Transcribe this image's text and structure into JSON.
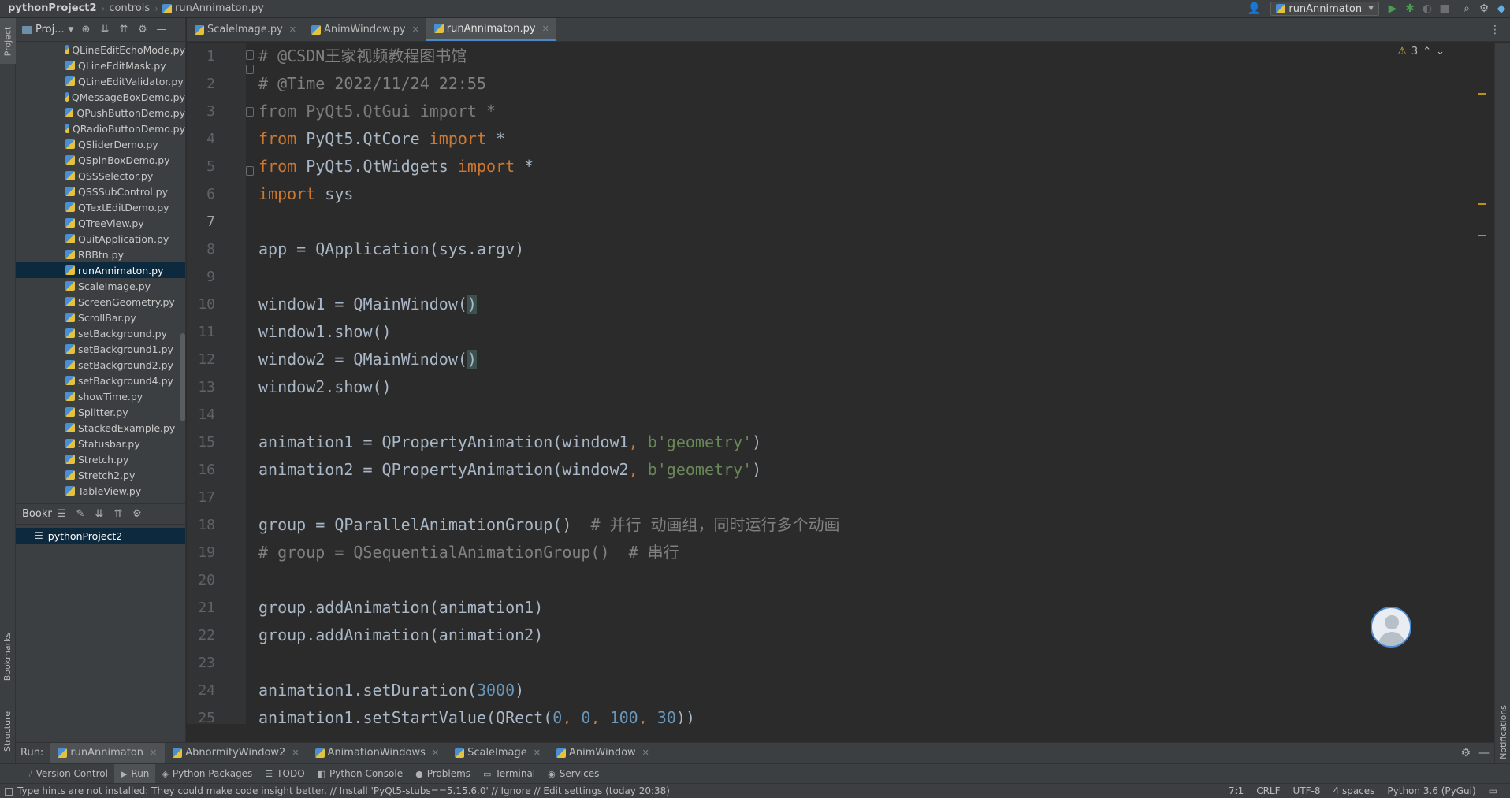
{
  "navbar": {
    "project": "pythonProject2",
    "folder": "controls",
    "file": "runAnnimaton.py",
    "run_config": "runAnnimaton"
  },
  "stripe": {
    "project_label": "Project",
    "bookmarks_label": "Bookmarks",
    "structure_label": "Structure",
    "notifications_label": "Notifications"
  },
  "project_panel": {
    "title": "Proj...",
    "files": [
      "QLineEditEchoMode.py",
      "QLineEditMask.py",
      "QLineEditValidator.py",
      "QMessageBoxDemo.py",
      "QPushButtonDemo.py",
      "QRadioButtonDemo.py",
      "QSliderDemo.py",
      "QSpinBoxDemo.py",
      "QSSSelector.py",
      "QSSSubControl.py",
      "QTextEditDemo.py",
      "QTreeView.py",
      "QuitApplication.py",
      "RBBtn.py",
      "runAnnimaton.py",
      "ScaleImage.py",
      "ScreenGeometry.py",
      "ScrollBar.py",
      "setBackground.py",
      "setBackground1.py",
      "setBackground2.py",
      "setBackground4.py",
      "showTime.py",
      "Splitter.py",
      "StackedExample.py",
      "Statusbar.py",
      "Stretch.py",
      "Stretch2.py",
      "TableView.py"
    ],
    "selected_index": 14
  },
  "bookmarks_panel": {
    "title": "Bookm",
    "item": "pythonProject2"
  },
  "editor_tabs": [
    {
      "label": "ScaleImage.py",
      "active": false
    },
    {
      "label": "AnimWindow.py",
      "active": false
    },
    {
      "label": "runAnnimaton.py",
      "active": true
    }
  ],
  "editor": {
    "warnings": "3",
    "line_numbers": [
      "1",
      "2",
      "3",
      "4",
      "5",
      "6",
      "7",
      "8",
      "9",
      "10",
      "11",
      "12",
      "13",
      "14",
      "15",
      "16",
      "17",
      "18",
      "19",
      "20",
      "21",
      "22",
      "23",
      "24",
      "25"
    ],
    "current_line": "7",
    "code": {
      "l1": "# @CSDN王家视频教程图书馆",
      "l2": "# @Time 2022/11/24 22:55",
      "l3a": "from ",
      "l3b": "PyQt5.QtGui ",
      "l3c": "import ",
      "l3d": "*",
      "l4a": "from ",
      "l4b": "PyQt5.QtCore ",
      "l4c": "import ",
      "l4d": "*",
      "l5a": "from ",
      "l5b": "PyQt5.QtWidgets ",
      "l5c": "import ",
      "l5d": "*",
      "l6a": "import ",
      "l6b": "sys",
      "l8": "app = QApplication(sys.argv)",
      "l10a": "window1 = QMainWindow(",
      "l10b": ")",
      "l11": "window1.show()",
      "l12a": "window2 = QMainWindow(",
      "l12b": ")",
      "l13": "window2.show()",
      "l15a": "animation1 = QPropertyAnimation(window1",
      "l15b": ", ",
      "l15c": "b'geometry'",
      "l15d": ")",
      "l16a": "animation2 = QPropertyAnimation(window2",
      "l16b": ", ",
      "l16c": "b'geometry'",
      "l16d": ")",
      "l18a": "group = QParallelAnimationGroup()  ",
      "l18b": "# 并行 动画组，同时运行多个动画",
      "l19": "# group = QSequentialAnimationGroup()  # 串行",
      "l21": "group.addAnimation(animation1)",
      "l22": "group.addAnimation(animation2)",
      "l24a": "animation1.setDuration(",
      "l24b": "3000",
      "l24c": ")",
      "l25a": "animation1.setStartValue(QRect(",
      "l25b": "0",
      "l25c": ", ",
      "l25d": "0",
      "l25e": ", ",
      "l25f": "100",
      "l25g": ", ",
      "l25h": "30",
      "l25i": "))"
    }
  },
  "run_bar": {
    "label": "Run:",
    "tabs": [
      "runAnnimaton",
      "AbnormityWindow2",
      "AnimationWindows",
      "ScaleImage",
      "AnimWindow"
    ]
  },
  "tool_windows": [
    "Version Control",
    "Run",
    "Python Packages",
    "TODO",
    "Python Console",
    "Problems",
    "Terminal",
    "Services"
  ],
  "status": {
    "message": "Type hints are not installed: They could make code insight better. // Install 'PyQt5-stubs==5.15.6.0' // Ignore // Edit settings (today 20:38)",
    "position": "7:1",
    "line_sep": "CRLF",
    "encoding": "UTF-8",
    "indent": "4 spaces",
    "interpreter": "Python 3.6 (PyGui)"
  },
  "colors": {
    "keyword": "#cc7832",
    "comment": "#808080",
    "string": "#6a8759",
    "number": "#6897bb",
    "default": "#a9b7c6",
    "selection": "#0d293e"
  }
}
